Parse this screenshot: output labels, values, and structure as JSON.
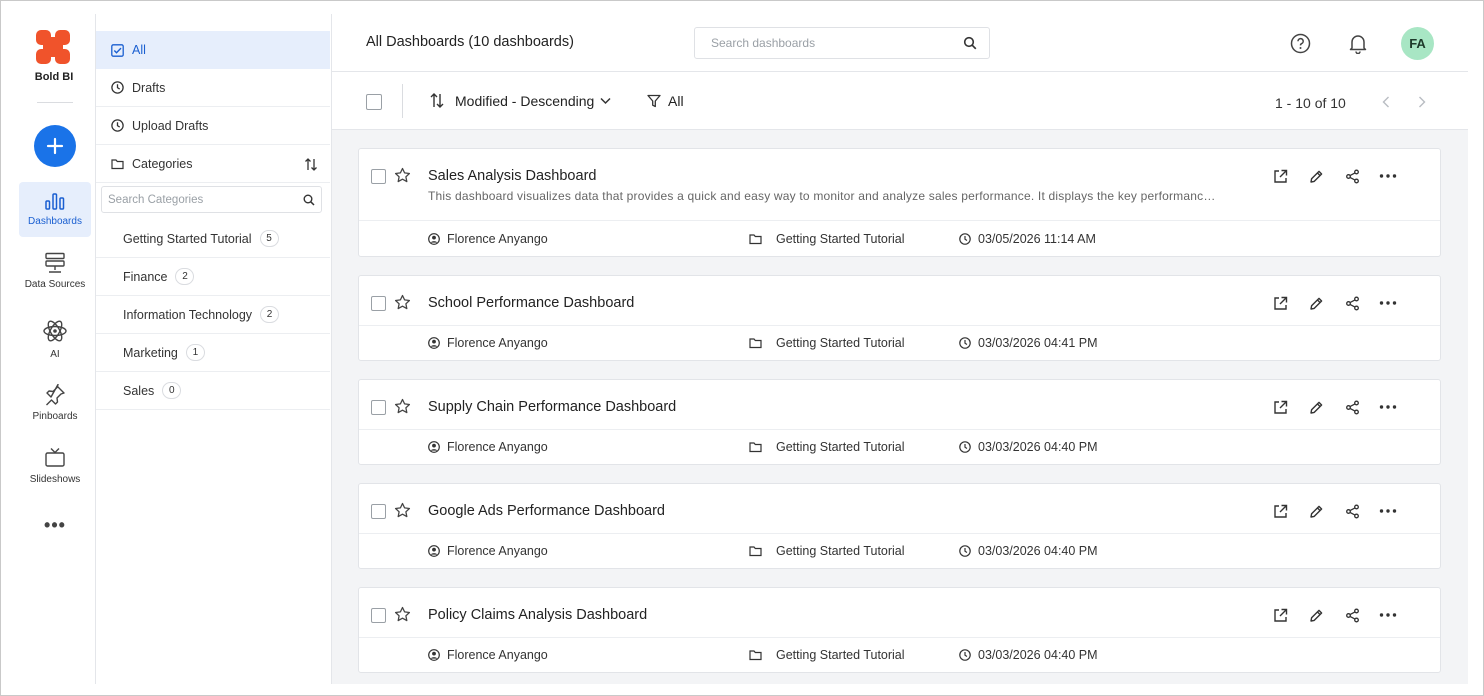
{
  "app": {
    "logo_text": "Bold BI"
  },
  "rail": [
    {
      "label": "Dashboards",
      "icon": "bar-chart-icon",
      "active": true
    },
    {
      "label": "Data Sources",
      "icon": "database-icon"
    },
    {
      "label": "AI",
      "icon": "atom-icon"
    },
    {
      "label": "Pinboards",
      "icon": "pin-icon"
    },
    {
      "label": "Slideshows",
      "icon": "tv-icon"
    }
  ],
  "categories_panel": {
    "all": "All",
    "drafts": "Drafts",
    "upload_drafts": "Upload Drafts",
    "categories": "Categories",
    "search_placeholder": "Search Categories",
    "items": [
      {
        "name": "Getting Started Tutorial",
        "count": "5"
      },
      {
        "name": "Finance",
        "count": "2"
      },
      {
        "name": "Information Technology",
        "count": "2"
      },
      {
        "name": "Marketing",
        "count": "1"
      },
      {
        "name": "Sales",
        "count": "0"
      }
    ]
  },
  "header": {
    "title": "All Dashboards (10 dashboards)",
    "search_placeholder": "Search dashboards",
    "avatar": "FA"
  },
  "toolbar": {
    "sort": "Modified - Descending",
    "filter": "All",
    "pagination": "1 - 10 of 10"
  },
  "dashboards": [
    {
      "title": "Sales Analysis Dashboard",
      "description": "This dashboard visualizes data that provides a quick and easy way to monitor and analyze sales performance. It displays the key performance indicators.",
      "owner": "Florence Anyango",
      "category": "Getting Started Tutorial",
      "modified": "03/05/2026 11:14 AM"
    },
    {
      "title": "School Performance Dashboard",
      "owner": "Florence Anyango",
      "category": "Getting Started Tutorial",
      "modified": "03/03/2026 04:41 PM"
    },
    {
      "title": "Supply Chain Performance Dashboard",
      "owner": "Florence Anyango",
      "category": "Getting Started Tutorial",
      "modified": "03/03/2026 04:40 PM"
    },
    {
      "title": "Google Ads Performance Dashboard",
      "owner": "Florence Anyango",
      "category": "Getting Started Tutorial",
      "modified": "03/03/2026 04:40 PM"
    },
    {
      "title": "Policy Claims Analysis Dashboard",
      "owner": "Florence Anyango",
      "category": "Getting Started Tutorial",
      "modified": "03/03/2026 04:40 PM"
    }
  ],
  "colors": {
    "accent": "#1a73e8",
    "avatar_bg": "#a8e6c4",
    "brand": "#f0532b"
  }
}
